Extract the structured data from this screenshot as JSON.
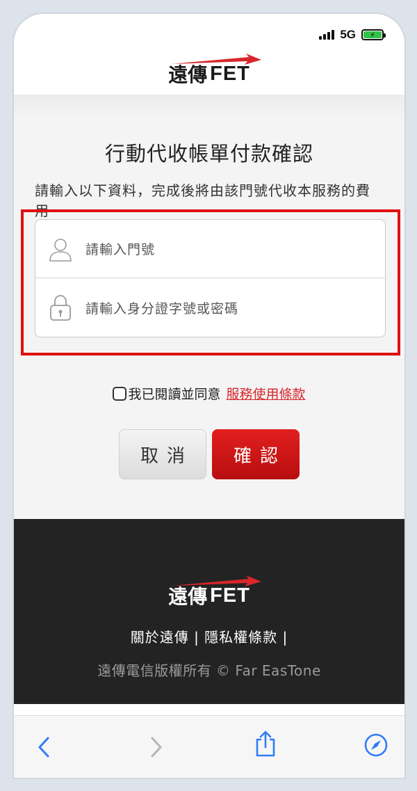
{
  "status_bar": {
    "network": "5G",
    "battery_charging": true
  },
  "brand": {
    "logo_zh": "遠傳",
    "logo_en": "FET",
    "accent_color": "#d8262b"
  },
  "page": {
    "title": "行動代收帳單付款確認",
    "description": "請輸入以下資料，完成後將由該門號代收本服務的費用"
  },
  "form": {
    "phone_placeholder": "請輸入門號",
    "id_placeholder": "請輸入身分證字號或密碼",
    "highlight_color": "#e01010"
  },
  "agreement": {
    "label": "我已閱讀並同意",
    "terms_link": "服務使用條款",
    "checked": false
  },
  "buttons": {
    "cancel": "取消",
    "confirm": "確認"
  },
  "footer": {
    "links": "關於遠傳 | 隱私權條款 |",
    "copyright": "遠傳電信版權所有 © Far EasTone"
  },
  "toolbar": {
    "icons": [
      "back-icon",
      "forward-icon",
      "share-icon",
      "compass-icon"
    ]
  }
}
